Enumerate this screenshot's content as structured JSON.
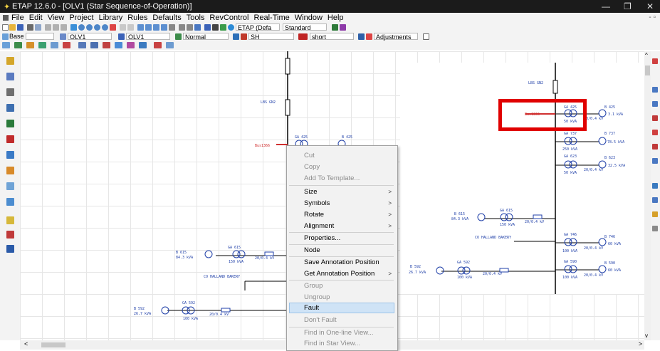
{
  "window": {
    "title": "ETAP 12.6.0 - [OLV1 (Star Sequence-of-Operation)]",
    "minimize": "—",
    "restore": "❐",
    "close": "✕",
    "mdi_controls": "- ▫"
  },
  "menu": [
    "File",
    "Edit",
    "View",
    "Project",
    "Library",
    "Rules",
    "Defaults",
    "Tools",
    "RevControl",
    "Real-Time",
    "Window",
    "Help"
  ],
  "toolbar": {
    "etap_dropdown": "ETAP (Defa",
    "standard_dropdown": "Standard",
    "base_label": "Base",
    "olv1_dropdown": "OLV1",
    "olv1_dropdown2": "OLV1",
    "normal_dropdown": "Normal",
    "sh_dropdown": "SH",
    "short_dropdown": "short",
    "adjustments_dropdown": "Adjustments"
  },
  "colors": {
    "accent_red": "#e00000",
    "bus_red": "#d03030",
    "element_blue": "#1f3fa8",
    "highlight": "#cfe3f6"
  },
  "diagram": {
    "left": {
      "lbs": "LBS GN2",
      "bus_label": "Bus1366",
      "ga425": "GA 425",
      "b425": "B 425",
      "b615": "B 615",
      "b615_kva": "84.3 kVA",
      "ga615": "GA 615",
      "ga615_kva": "150 kVA",
      "ga615_v": "20/0.4 kV",
      "halland": "CO HALLAND BAKERY",
      "b592": "B 592",
      "b592_kva": "26.7 kVA",
      "ga592": "GA 592",
      "ga592_kva": "100 kVA",
      "ga592_v": "20/0.4 kV"
    },
    "right": {
      "lbs": "LBS GN2",
      "bus_label": "Bus1366",
      "ga425": "GA 425",
      "ga425_kva": "50 kVA",
      "b425": "B 425",
      "b425_kva": "3.1 kVA",
      "ga425_v": "20/0.4 kV",
      "ga737": "GA 737",
      "b737": "B 737",
      "b737_kva": "78.5 kVA",
      "ga737_kva": "250 kVA",
      "ga623": "GA 623",
      "b623": "B 623",
      "b623_kva": "32.5 kVA",
      "ga623_kva": "50 kVA",
      "ga623_v": "20/0.4 kV",
      "b615": "B 615",
      "b615_kva": "84.3 kVA",
      "ga615": "GA 615",
      "ga615_kva": "150 kVA",
      "ga615_v": "20/0.4 kV",
      "halland": "CO HALLAND BAKERY",
      "ga746": "GA 746",
      "b746": "B 746",
      "b746_kva": "60 kVA",
      "ga746_kva": "100 kVA",
      "ga746_v": "20/0.4 kV",
      "b592": "B 592",
      "b592_kva": "26.7 kVA",
      "ga592": "GA 592",
      "ga592_kva": "100 kVA",
      "ga592_v": "20/0.4 kV",
      "ga590": "GA 590",
      "b590": "B 590",
      "b590_kva": "60 kVA",
      "ga590_kva": "100 kVA",
      "ga590_v": "20/0.4 kV"
    }
  },
  "context_menu": {
    "cut": "Cut",
    "copy": "Copy",
    "add_to_template": "Add To Template...",
    "size": "Size",
    "symbols": "Symbols",
    "rotate": "Rotate",
    "alignment": "Alignment",
    "properties": "Properties...",
    "node": "Node",
    "save_annotation": "Save Annotation Position",
    "get_annotation": "Get Annotation Position",
    "group": "Group",
    "ungroup": "Ungroup",
    "fault": "Fault",
    "dont_fault": "Don't Fault",
    "find_one_line": "Find in One-line View...",
    "find_star": "Find in Star View..."
  },
  "scroll": {
    "up": "^",
    "down": "v",
    "left": "<",
    "right": ">"
  }
}
